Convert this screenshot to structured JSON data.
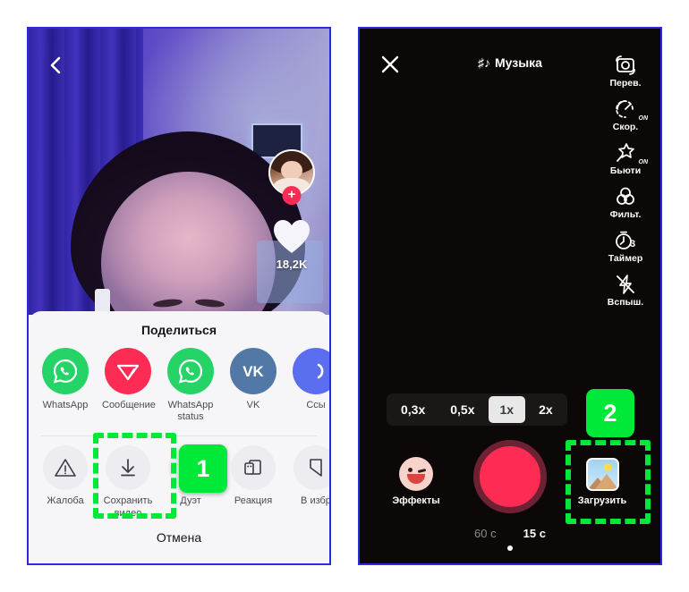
{
  "left_panel": {
    "back_icon": "chevron-left-icon",
    "video": {
      "author_avatar": "avatar",
      "follow_badge": "plus-icon",
      "like_icon": "heart-icon",
      "like_count": "18,2K"
    },
    "share_sheet": {
      "title": "Поделиться",
      "apps": [
        {
          "label": "WhatsApp",
          "icon": "whatsapp-icon",
          "color": "#25d366"
        },
        {
          "label": "Сообщение",
          "icon": "direct-message-icon",
          "color": "#fe2c55"
        },
        {
          "label": "WhatsApp status",
          "icon": "whatsapp-status-icon",
          "color": "#25d366"
        },
        {
          "label": "VK",
          "icon": "vk-icon",
          "color": "#5278a8"
        },
        {
          "label": "Ссы",
          "icon": "copy-link-icon",
          "color": "#5b6ef0"
        }
      ],
      "actions": [
        {
          "label": "Жалоба",
          "icon": "warning-triangle-icon"
        },
        {
          "label": "Сохранить видео",
          "icon": "download-icon"
        },
        {
          "label": "Дуэт",
          "icon": "duet-icon"
        },
        {
          "label": "Реакция",
          "icon": "reaction-icon"
        },
        {
          "label": "В избр",
          "icon": "bookmark-icon"
        }
      ],
      "cancel_label": "Отмена"
    }
  },
  "right_panel": {
    "close_icon": "close-icon",
    "music": {
      "label": "Музыка",
      "icon": "music-note-icon"
    },
    "tools": [
      {
        "label": "Перев.",
        "icon": "flip-camera-icon",
        "state": ""
      },
      {
        "label": "Скор.",
        "icon": "speed-icon",
        "state": "ON"
      },
      {
        "label": "Бьюти",
        "icon": "beauty-wand-icon",
        "state": "ON"
      },
      {
        "label": "Фильт.",
        "icon": "filters-icon",
        "state": ""
      },
      {
        "label": "Таймер",
        "icon": "timer-icon",
        "state": "3"
      },
      {
        "label": "Вспыш.",
        "icon": "flash-off-icon",
        "state": ""
      }
    ],
    "zoom_levels": [
      {
        "label": "0,3x",
        "selected": false
      },
      {
        "label": "0,5x",
        "selected": false
      },
      {
        "label": "1x",
        "selected": true
      },
      {
        "label": "2x",
        "selected": false
      }
    ],
    "effects": {
      "label": "Эффекты",
      "icon": "smiley-wink-icon"
    },
    "record_button": "record-button",
    "upload": {
      "label": "Загрузить",
      "icon": "gallery-thumbnail-icon"
    },
    "durations": [
      {
        "label": "60 с",
        "selected": false
      },
      {
        "label": "15 с",
        "selected": true
      }
    ]
  },
  "annotations": {
    "badge_1": "1",
    "badge_2": "2",
    "highlight_color": "#00e838"
  }
}
